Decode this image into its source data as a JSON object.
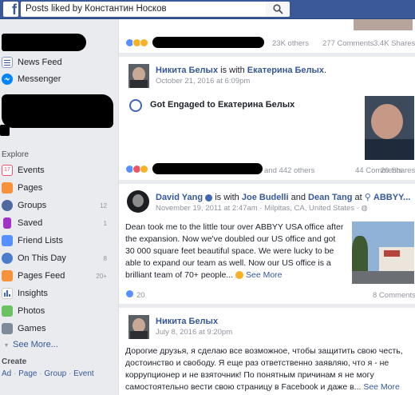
{
  "search": {
    "value": "Posts liked by Константин Носков"
  },
  "sidebar": {
    "news_feed": "News Feed",
    "messenger": "Messenger",
    "explore_header": "Explore",
    "items": [
      {
        "label": "Events",
        "count": ""
      },
      {
        "label": "Pages",
        "count": ""
      },
      {
        "label": "Groups",
        "count": "12"
      },
      {
        "label": "Saved",
        "count": "1"
      },
      {
        "label": "Friend Lists",
        "count": ""
      },
      {
        "label": "On This Day",
        "count": "8"
      },
      {
        "label": "Pages Feed",
        "count": "20+"
      },
      {
        "label": "Insights",
        "count": ""
      },
      {
        "label": "Photos",
        "count": ""
      },
      {
        "label": "Games",
        "count": ""
      }
    ],
    "see_more": "See More...",
    "create_header": "Create",
    "create_links": [
      "Ad",
      "Page",
      "Group",
      "Event"
    ]
  },
  "posts": [
    {
      "reactions_tail": "23K others",
      "comments": "277 Comments",
      "shares": "3.4K Shares"
    },
    {
      "author": "Никита Белых",
      "connector": "is with",
      "tagged": "Екатерина Белых",
      "date": "October 21, 2016 at 6:09pm",
      "event": "Got Engaged to Екатерина Белых",
      "reactions_tail": "and 442 others",
      "comments": "44 Comments",
      "shares": "20 Shares"
    },
    {
      "author": "David Yang",
      "connector": "is with",
      "tagged1": "Joe Budelli",
      "and": "and",
      "tagged2": "Dean Tang",
      "at": "at",
      "place": "ABBYY...",
      "date": "November 19, 2011 at 2:47am",
      "location": "Milpitas, CA, United States",
      "text": "Dean took me to the little tour over ABBYY USA office after the expansion. Now we've doubled our US office and got 30 000 square feet beautiful space. We were lucky to be able to expand our team as well. Now our US office is a brilliant team of 70+ people...",
      "see_more": "See More",
      "reactions": "20",
      "comments": "8 Comments"
    },
    {
      "author": "Никита Белых",
      "date": "July 8, 2016 at 9:20pm",
      "text": "Дорогие друзья, я сделаю все возможное, чтобы защитить свою честь, достоинство и свободу. Я еще раз ответственно заявляю, что я - не коррупционер и не взяточник! По понятным причинам я не могу самостоятельно вести свою страницу в Facebook и даже в...",
      "see_more": "See More"
    }
  ]
}
